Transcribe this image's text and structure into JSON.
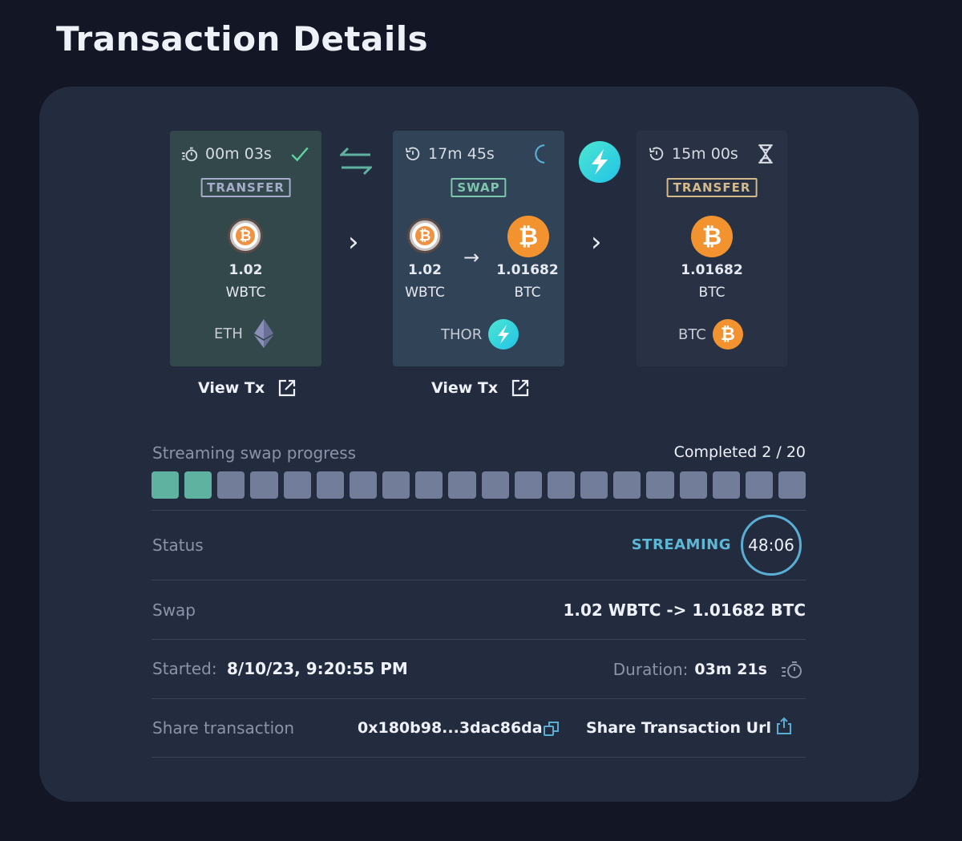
{
  "page": {
    "title": "Transaction Details"
  },
  "steps": [
    {
      "timer": "00m 03s",
      "status_icon": "check-icon",
      "type": "TRANSFER",
      "amount": "1.02",
      "ticker": "WBTC",
      "chain": "ETH",
      "view_tx": "View Tx"
    },
    {
      "timer": "17m 45s",
      "status_icon": "spinner-icon",
      "type": "SWAP",
      "from_amount": "1.02",
      "from_ticker": "WBTC",
      "to_amount": "1.01682",
      "to_ticker": "BTC",
      "chain": "THOR",
      "view_tx": "View Tx"
    },
    {
      "timer": "15m 00s",
      "status_icon": "hourglass-icon",
      "type": "TRANSFER",
      "amount": "1.01682",
      "ticker": "BTC",
      "chain": "BTC"
    }
  ],
  "progress": {
    "label": "Streaming swap progress",
    "completed_text": "Completed 2 / 20",
    "completed": 2,
    "total": 20
  },
  "status": {
    "label": "Status",
    "value": "STREAMING",
    "countdown": "48:06"
  },
  "swap": {
    "label": "Swap",
    "value": "1.02 WBTC -> 1.01682 BTC"
  },
  "started": {
    "label": "Started:",
    "value": "8/10/23, 9:20:55 PM"
  },
  "duration": {
    "label": "Duration:",
    "value": "03m 21s"
  },
  "share": {
    "label": "Share transaction",
    "hash": "0x180b98...3dac86da",
    "url_label": "Share Transaction Url"
  },
  "colors": {
    "background": "#131725",
    "card": "#232c3f",
    "accent_green": "#5fb2a0",
    "accent_blue": "#5cb8d6",
    "btc_orange": "#f2932f"
  }
}
